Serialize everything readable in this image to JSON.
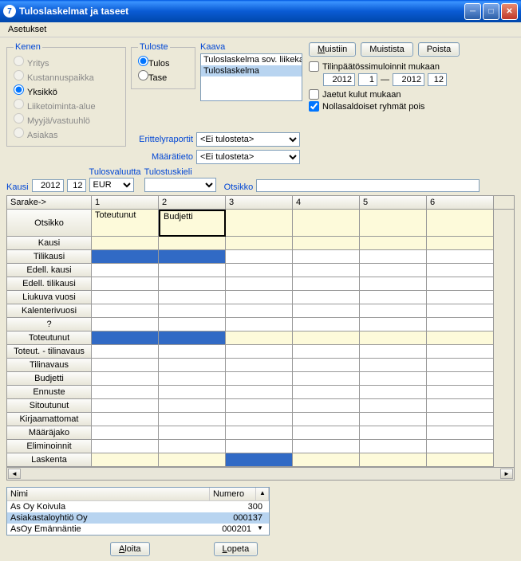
{
  "window": {
    "title": "Tuloslaskelmat ja taseet"
  },
  "menu": {
    "asetukset": "Asetukset"
  },
  "kenen": {
    "legend": "Kenen",
    "yritys": "Yritys",
    "kustannus": "Kustannuspaikka",
    "yksikko": "Yksikkö",
    "liiketoiminta": "Liiketoiminta-alue",
    "myyja": "Myyjä/vastuuhlö",
    "asiakas": "Asiakas"
  },
  "tuloste": {
    "legend": "Tuloste",
    "tulos": "Tulos",
    "tase": "Tase"
  },
  "kaava": {
    "label": "Kaava",
    "items": [
      "Tuloslaskelma sov. liikekaava",
      "Tuloslaskelma"
    ]
  },
  "buttons": {
    "muistiin": "Muistiin",
    "muistista": "Muistista",
    "poista": "Poista",
    "aloita": "Aloita",
    "lopeta": "Lopeta"
  },
  "checks": {
    "tilinpaatos": "Tilinpäätössimuloinnit mukaan",
    "jaetut": "Jaetut kulut mukaan",
    "nollasaldo": "Nollasaldoiset ryhmät pois"
  },
  "years": {
    "y1": "2012",
    "m1": "1",
    "dash": "—",
    "y2": "2012",
    "m2": "12"
  },
  "erittely": {
    "label": "Erittelyraportit",
    "value": "<Ei tulosteta>"
  },
  "maaratieto": {
    "label": "Määrätieto",
    "value": "<Ei tulosteta>"
  },
  "kausi": {
    "label": "Kausi",
    "year": "2012",
    "month": "12"
  },
  "tulosvaluutta": {
    "label": "Tulosvaluutta",
    "value": "EUR"
  },
  "tulostuskieli": {
    "label": "Tulostuskieli",
    "value": ""
  },
  "otsikkofield": {
    "label": "Otsikko",
    "value": ""
  },
  "grid": {
    "sarake": "Sarake->",
    "cols": [
      "1",
      "2",
      "3",
      "4",
      "5",
      "6"
    ],
    "rows": [
      "Otsikko",
      "Kausi",
      "Tilikausi",
      "Edell. kausi",
      "Edell. tilikausi",
      "Liukuva vuosi",
      "Kalenterivuosi",
      "?",
      "Toteutunut",
      "Toteut. - tilinavaus",
      "Tilinavaus",
      "Budjetti",
      "Ennuste",
      "Sitoutunut",
      "Kirjaamattomat",
      "Määräjako",
      "Eliminoinnit",
      "Laskenta"
    ],
    "otsikko_vals": [
      "Toteutunut",
      "Budjetti"
    ]
  },
  "bottom": {
    "h1": "Nimi",
    "h2": "Numero",
    "rows": [
      {
        "nimi": "As Oy Koivula",
        "num": "300"
      },
      {
        "nimi": "Asiakastaloyhtiö Oy",
        "num": "000137"
      },
      {
        "nimi": "AsOy Emännäntie",
        "num": "000201"
      }
    ]
  }
}
